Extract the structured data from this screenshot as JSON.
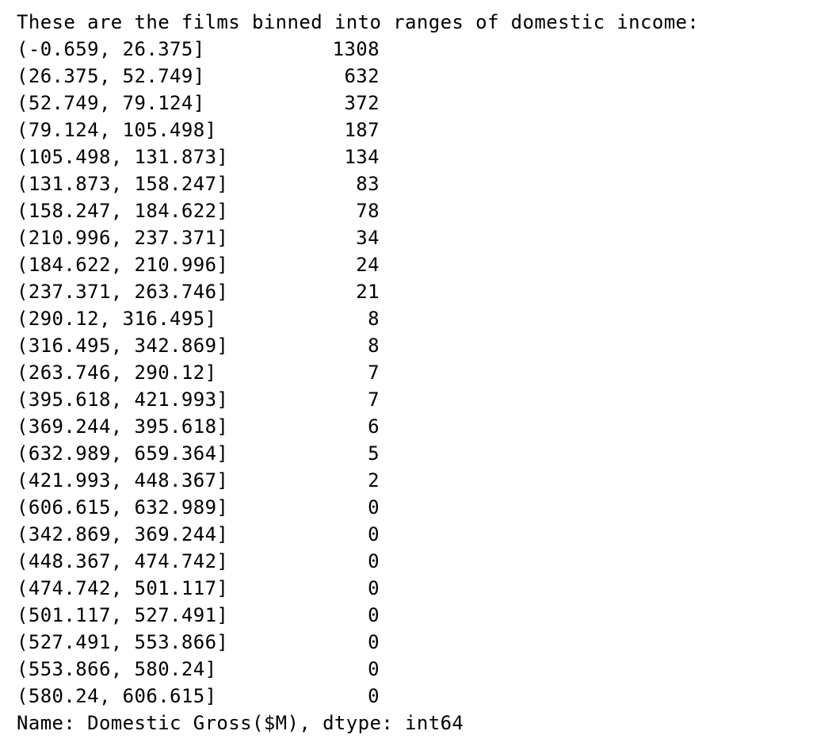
{
  "output": {
    "header": "These are the films binned into ranges of domestic income:",
    "rows": [
      {
        "bin": "(-0.659, 26.375]",
        "count": "1308"
      },
      {
        "bin": "(26.375, 52.749]",
        "count": "632"
      },
      {
        "bin": "(52.749, 79.124]",
        "count": "372"
      },
      {
        "bin": "(79.124, 105.498]",
        "count": "187"
      },
      {
        "bin": "(105.498, 131.873]",
        "count": "134"
      },
      {
        "bin": "(131.873, 158.247]",
        "count": "83"
      },
      {
        "bin": "(158.247, 184.622]",
        "count": "78"
      },
      {
        "bin": "(210.996, 237.371]",
        "count": "34"
      },
      {
        "bin": "(184.622, 210.996]",
        "count": "24"
      },
      {
        "bin": "(237.371, 263.746]",
        "count": "21"
      },
      {
        "bin": "(290.12, 316.495]",
        "count": "8"
      },
      {
        "bin": "(316.495, 342.869]",
        "count": "8"
      },
      {
        "bin": "(263.746, 290.12]",
        "count": "7"
      },
      {
        "bin": "(395.618, 421.993]",
        "count": "7"
      },
      {
        "bin": "(369.244, 395.618]",
        "count": "6"
      },
      {
        "bin": "(632.989, 659.364]",
        "count": "5"
      },
      {
        "bin": "(421.993, 448.367]",
        "count": "2"
      },
      {
        "bin": "(606.615, 632.989]",
        "count": "0"
      },
      {
        "bin": "(342.869, 369.244]",
        "count": "0"
      },
      {
        "bin": "(448.367, 474.742]",
        "count": "0"
      },
      {
        "bin": "(474.742, 501.117]",
        "count": "0"
      },
      {
        "bin": "(501.117, 527.491]",
        "count": "0"
      },
      {
        "bin": "(527.491, 553.866]",
        "count": "0"
      },
      {
        "bin": "(553.866, 580.24]",
        "count": "0"
      },
      {
        "bin": "(580.24, 606.615]",
        "count": "0"
      }
    ],
    "footer": "Name: Domestic Gross($M), dtype: int64"
  }
}
